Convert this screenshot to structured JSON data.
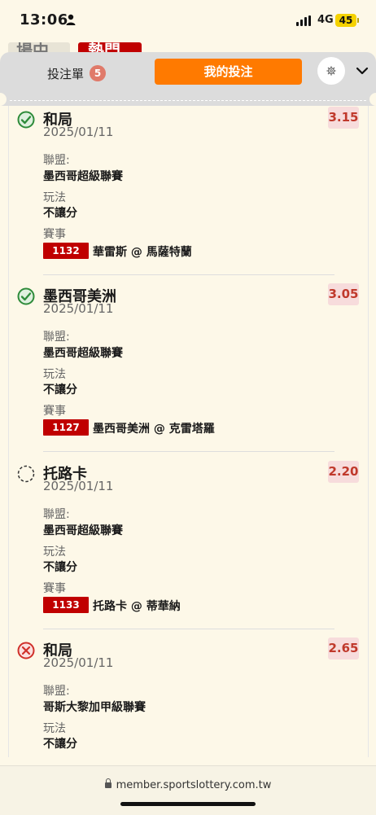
{
  "status_bar": {
    "time": "13:06",
    "network": "4G",
    "battery": "45"
  },
  "background": {
    "left_partial": "場中",
    "right_partial": "熱門"
  },
  "header": {
    "tab_betslip": "投注單",
    "betslip_count": "5",
    "tab_mybets": "我的投注",
    "icons": [
      "gear-icon",
      "chevron-down-icon"
    ]
  },
  "labels": {
    "league": "聯盟:",
    "play": "玩法",
    "event": "賽事"
  },
  "bets": [
    {
      "status": "won",
      "selection": "和局",
      "date": "2025/01/11",
      "odds": "3.15",
      "league": "墨西哥超級聯賽",
      "play": "不讓分",
      "match_id": "1132",
      "match": "華雷斯 @ 馬薩特蘭"
    },
    {
      "status": "won",
      "selection": "墨西哥美洲",
      "date": "2025/01/11",
      "odds": "3.05",
      "league": "墨西哥超級聯賽",
      "play": "不讓分",
      "match_id": "1127",
      "match": "墨西哥美洲 @ 克雷塔羅"
    },
    {
      "status": "pending",
      "selection": "托路卡",
      "date": "2025/01/11",
      "odds": "2.20",
      "league": "墨西哥超級聯賽",
      "play": "不讓分",
      "match_id": "1133",
      "match": "托路卡 @ 蒂華納"
    },
    {
      "status": "lost",
      "selection": "和局",
      "date": "2025/01/11",
      "odds": "2.65",
      "league": "哥斯大黎加甲級聯賽",
      "play": "不讓分",
      "match_id": "",
      "match": ""
    }
  ],
  "colors": {
    "accent": "#ff7a00",
    "won": "#2e8b3a",
    "lost": "#d0302a",
    "odds_text": "#c0392b",
    "match_badge": "#c00000"
  },
  "url_bar": {
    "domain": "member.sportslottery.com.tw"
  }
}
